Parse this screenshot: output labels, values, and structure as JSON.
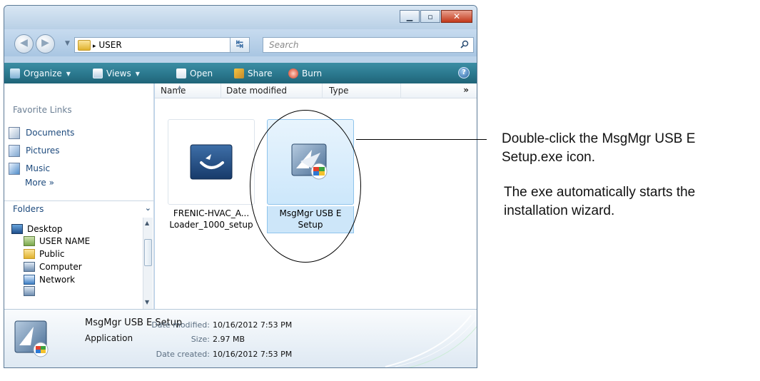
{
  "window": {
    "address": {
      "path": "USER",
      "separator": "▸"
    },
    "search": {
      "placeholder": "Search"
    },
    "toolbar": {
      "organize": "Organize",
      "views": "Views",
      "open": "Open",
      "share": "Share",
      "burn": "Burn"
    },
    "nav_pane": {
      "favorites_heading": "Favorite Links",
      "favorites": [
        "Documents",
        "Pictures",
        "Music"
      ],
      "more": "More »",
      "folders_heading": "Folders",
      "tree": [
        "Desktop",
        "USER NAME",
        "Public",
        "Computer",
        "Network"
      ]
    },
    "columns": {
      "name": "Name",
      "date_modified": "Date modified",
      "type": "Type",
      "more": "»"
    },
    "files": [
      {
        "label_line1": "FRENIC-HVAC_A...",
        "label_line2": "Loader_1000_setup",
        "selected": false
      },
      {
        "label_line1": "MsgMgr USB E",
        "label_line2": "Setup",
        "selected": true
      }
    ],
    "details": {
      "name": "MsgMgr USB E Setup",
      "type": "Application",
      "date_modified_label": "Date modified:",
      "date_modified": "10/16/2012 7:53 PM",
      "size_label": "Size:",
      "size": "2.97 MB",
      "date_created_label": "Date created:",
      "date_created": "10/16/2012 7:53 PM"
    }
  },
  "annotation": {
    "line1": "Double-click the MsgMgr USB E",
    "line2": "Setup.exe icon.",
    "line3": "The exe automatically starts the",
    "line4": "installation wizard."
  },
  "colors": {
    "command_bar": "#2c7a90",
    "selection": "#cde6f9",
    "link_text": "#1d4a7d"
  }
}
